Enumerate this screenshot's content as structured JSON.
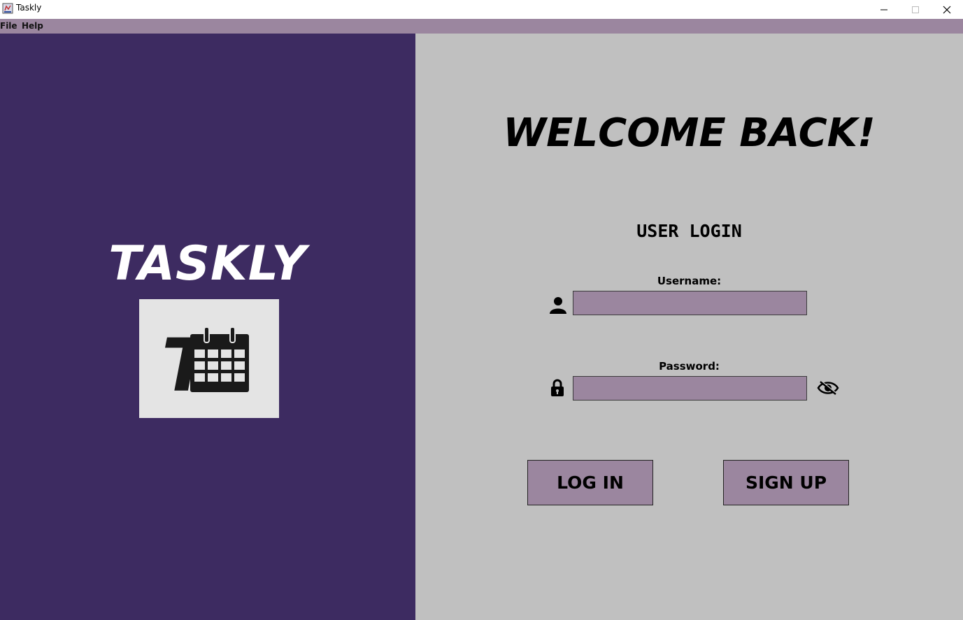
{
  "window": {
    "title": "Taskly",
    "app_icon": "java-cup-icon"
  },
  "menu": {
    "items": [
      {
        "label": "File"
      },
      {
        "label": "Help"
      }
    ]
  },
  "brand": {
    "name": "TASKLY",
    "logo": "taskly-calendar-logo",
    "logo_letter": "T"
  },
  "login": {
    "welcome": "WELCOME BACK!",
    "heading": "USER LOGIN",
    "username": {
      "label": "Username:",
      "value": "",
      "icon": "user-icon"
    },
    "password": {
      "label": "Password:",
      "value": "",
      "icon": "lock-icon",
      "toggle_icon": "eye-slash-icon"
    },
    "login_button": "LOG IN",
    "signup_button": "SIGN UP"
  },
  "colors": {
    "left_panel": "#3d2b61",
    "right_panel": "#c0c0c0",
    "accent": "#9b869f",
    "logo_bg": "#e4e4e4"
  }
}
